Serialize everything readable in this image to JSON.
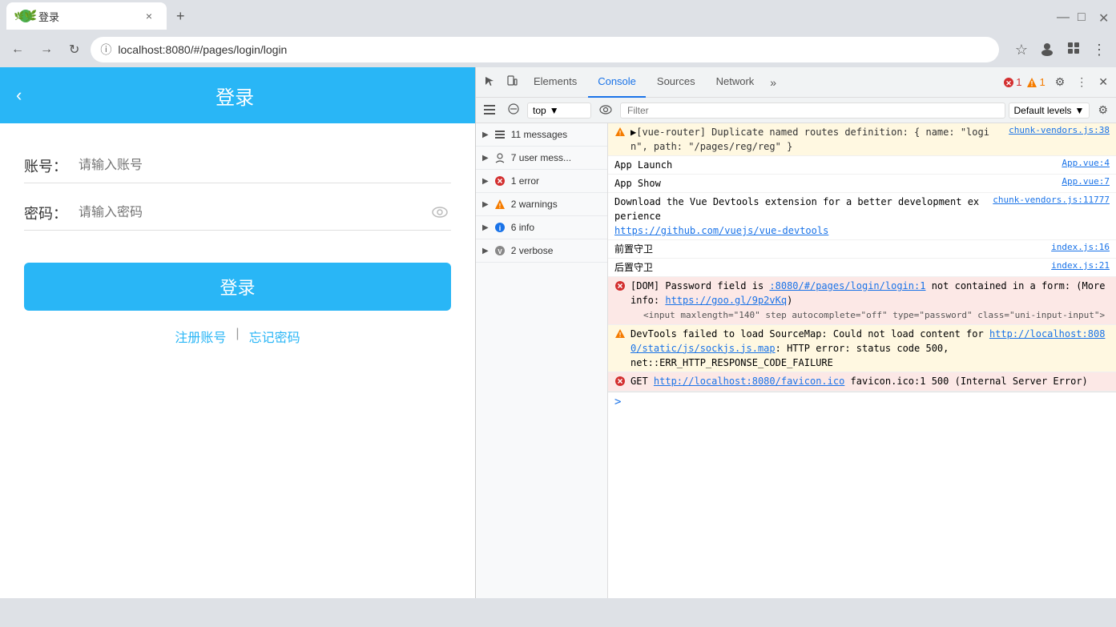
{
  "browser": {
    "tab_favicon": "🌿",
    "tab_title": "登录",
    "tab_close": "×",
    "new_tab_btn": "+",
    "window_minimize": "—",
    "window_maximize": "□",
    "window_close": "✕",
    "nav_back": "←",
    "nav_forward": "→",
    "nav_refresh": "↻",
    "address_info_icon": "ⓘ",
    "address_url": "localhost:8080/#/pages/login/login",
    "bookmark_icon": "☆",
    "more_icon": "⋮"
  },
  "login": {
    "header_title": "登录",
    "back_label": "‹",
    "account_label": "账号：",
    "account_placeholder": "请输入账号",
    "password_label": "密码：",
    "password_placeholder": "请输入密码",
    "eye_icon": "👁",
    "login_btn": "登录",
    "register_link": "注册账号",
    "divider": "|",
    "forgot_link": "忘记密码"
  },
  "devtools": {
    "toolbar": {
      "cursor_icon": "⊹",
      "device_icon": "⬜",
      "elements_tab": "Elements",
      "console_tab": "Console",
      "sources_tab": "Sources",
      "network_tab": "Network",
      "more_tabs": "»",
      "error_count": "1",
      "warn_count": "1",
      "settings_icon": "⚙",
      "menu_icon": "⋮",
      "close_icon": "✕"
    },
    "console_toolbar": {
      "ban_icon": "⊘",
      "context_value": "top",
      "context_arrow": "▼",
      "eye_icon": "◎",
      "filter_placeholder": "Filter",
      "levels_label": "Default levels",
      "levels_arrow": "▼",
      "settings_icon": "⚙"
    },
    "sidebar": {
      "items": [
        {
          "id": "all-messages",
          "expand": "▶",
          "icon_type": "list",
          "label": "11 messages"
        },
        {
          "id": "user-messages",
          "expand": "▶",
          "icon_type": "user",
          "label": "7 user mess..."
        },
        {
          "id": "errors",
          "expand": "▶",
          "icon_type": "error",
          "label": "1 error"
        },
        {
          "id": "warnings",
          "expand": "▶",
          "icon_type": "warn",
          "label": "2 warnings"
        },
        {
          "id": "info",
          "expand": "▶",
          "icon_type": "info",
          "label": "6 info"
        },
        {
          "id": "verbose",
          "expand": "▶",
          "icon_type": "verbose",
          "label": "2 verbose"
        }
      ]
    },
    "console_log": [
      {
        "type": "warn",
        "icon": "⚠",
        "text": "▶[vue-router] Duplicate named routes definition: { name: \"login\", path: \"/pages/reg/reg\" }",
        "link_text": "chunk-vendors.js:38",
        "link_url": "#"
      },
      {
        "type": "info",
        "icon": "",
        "text": "App Launch",
        "link_text": "App.vue:4"
      },
      {
        "type": "info",
        "icon": "",
        "text": "App Show",
        "link_text": "App.vue:7"
      },
      {
        "type": "info",
        "icon": "",
        "text_parts": [
          {
            "text": "Download the Vue Devtools extension for a better development experience\n",
            "plain": true
          },
          {
            "text": "https://github.com/vuejs/vue-devtools",
            "is_link": true
          }
        ],
        "link_text": "chunk-vendors.js:11777"
      },
      {
        "type": "info",
        "icon": "",
        "text": "前置守卫",
        "link_text": "index.js:16"
      },
      {
        "type": "info",
        "icon": "",
        "text": "后置守卫",
        "link_text": "index.js:21"
      },
      {
        "type": "error",
        "icon": "✕",
        "text_parts": [
          {
            "text": "[DOM] Password field is ",
            "plain": true
          },
          {
            "text": ":8080/#/pages/login/login:1",
            "is_link": true
          },
          {
            "text": " not contained in a form: (More info: ",
            "plain": true
          },
          {
            "text": "https://goo.gl/9p2vKq",
            "is_link": true
          },
          {
            "text": ")",
            "plain": true
          }
        ],
        "code_line": "<input maxlength=\"140\" step autocomplete=\"off\" type=\"password\" class=\"uni-input-input\">",
        "link_text": ""
      },
      {
        "type": "warn",
        "icon": "⚠",
        "text_parts": [
          {
            "text": "DevTools failed to load SourceMap: Could not load content for ",
            "plain": true
          },
          {
            "text": "http://localhost:8080/static/js/sockjs.js.map",
            "is_link": true
          },
          {
            "text": ": HTTP error: status code 500, net::ERR_HTTP_RESPONSE_CODE_FAILURE",
            "plain": true
          }
        ]
      },
      {
        "type": "error",
        "icon": "✕",
        "text_parts": [
          {
            "text": "GET ",
            "plain": true
          },
          {
            "text": "http://localhost:8080/favicon.ico",
            "is_link": true
          },
          {
            "text": " favicon.ico:1 500 (Internal Server Error)",
            "plain": true
          }
        ]
      }
    ],
    "prompt_arrow": ">"
  }
}
